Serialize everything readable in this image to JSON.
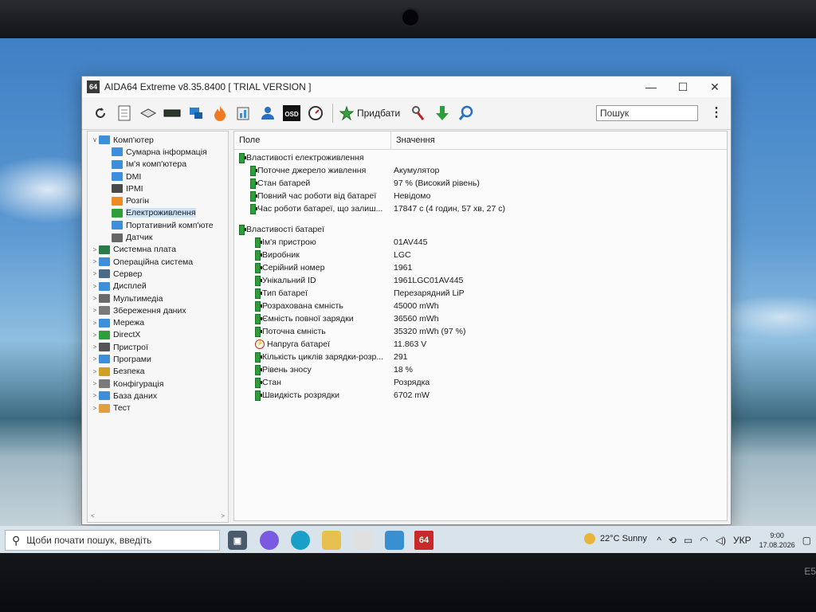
{
  "window": {
    "app_icon_text": "64",
    "title": "AIDA64 Extreme v8.35.8400  [ TRIAL VERSION ]",
    "minimize": "—",
    "maximize": "☐",
    "close": "✕"
  },
  "toolbar": {
    "add_label": "Придбати",
    "search_placeholder": "Пошук",
    "icons": [
      "refresh-icon",
      "report-icon",
      "motherboard-icon",
      "memory-icon",
      "network-icon",
      "flame-icon",
      "benchmark-icon",
      "user-icon",
      "osd-icon",
      "gauge-icon"
    ]
  },
  "tree": {
    "items": [
      {
        "label": "Комп'ютер",
        "level": 0,
        "expand": "∨",
        "color": "#3c8fd8"
      },
      {
        "label": "Сумарна інформація",
        "level": 1,
        "expand": "",
        "color": "#3c8fd8"
      },
      {
        "label": "Ім'я комп'ютера",
        "level": 1,
        "expand": "",
        "color": "#3c8fd8"
      },
      {
        "label": "DMI",
        "level": 1,
        "expand": "",
        "color": "#3c8fd8"
      },
      {
        "label": "IPMI",
        "level": 1,
        "expand": "",
        "color": "#4a4a4a"
      },
      {
        "label": "Розгін",
        "level": 1,
        "expand": "",
        "color": "#f08a24"
      },
      {
        "label": "Електроживлення",
        "level": 1,
        "expand": "",
        "color": "#2e9e3a",
        "selected": true
      },
      {
        "label": "Портативний комп'юте",
        "level": 1,
        "expand": "",
        "color": "#3c8fd8"
      },
      {
        "label": "Датчик",
        "level": 1,
        "expand": "",
        "color": "#666666"
      },
      {
        "label": "Системна плата",
        "level": 0,
        "expand": ">",
        "color": "#2a7a4a"
      },
      {
        "label": "Операційна система",
        "level": 0,
        "expand": ">",
        "color": "#3c8fd8"
      },
      {
        "label": "Сервер",
        "level": 0,
        "expand": ">",
        "color": "#4a6a8a"
      },
      {
        "label": "Дисплей",
        "level": 0,
        "expand": ">",
        "color": "#3c8fd8"
      },
      {
        "label": "Мультимедіа",
        "level": 0,
        "expand": ">",
        "color": "#6a6a6a"
      },
      {
        "label": "Збереження даних",
        "level": 0,
        "expand": ">",
        "color": "#7a7a7a"
      },
      {
        "label": "Мережа",
        "level": 0,
        "expand": ">",
        "color": "#3c8fd8"
      },
      {
        "label": "DirectX",
        "level": 0,
        "expand": ">",
        "color": "#2e9e3a"
      },
      {
        "label": "Пристрої",
        "level": 0,
        "expand": ">",
        "color": "#555555"
      },
      {
        "label": "Програми",
        "level": 0,
        "expand": ">",
        "color": "#3c8fd8"
      },
      {
        "label": "Безпека",
        "level": 0,
        "expand": ">",
        "color": "#d0a020"
      },
      {
        "label": "Конфігурація",
        "level": 0,
        "expand": ">",
        "color": "#7a7a7a"
      },
      {
        "label": "База даних",
        "level": 0,
        "expand": ">",
        "color": "#3c8fd8"
      },
      {
        "label": "Тест",
        "level": 0,
        "expand": ">",
        "color": "#e0a040"
      }
    ]
  },
  "panel": {
    "col_field": "Поле",
    "col_value": "Значення",
    "groups": [
      {
        "title": "Властивості електроживлення",
        "rows": [
          {
            "field": "Поточне джерело живлення",
            "value": "Акумулятор"
          },
          {
            "field": "Стан батарей",
            "value": "97 % (Високий рівень)"
          },
          {
            "field": "Повний час роботи від батареї",
            "value": "Невідомо"
          },
          {
            "field": "Час роботи батареї, що залиш...",
            "value": "17847 с (4 годин, 57 хв, 27 с)"
          }
        ]
      },
      {
        "title": "Властивості батареї",
        "rows": [
          {
            "field": "Ім'я пристрою",
            "value": "01AV445"
          },
          {
            "field": "Виробник",
            "value": "LGC"
          },
          {
            "field": "Серійний номер",
            "value": "1961"
          },
          {
            "field": "Унікальний ID",
            "value": "1961LGC01AV445"
          },
          {
            "field": "Тип батареї",
            "value": "Перезарядний LiP"
          },
          {
            "field": "Розрахована ємність",
            "value": "45000 mWh"
          },
          {
            "field": "Ємність повної зарядки",
            "value": "36560 mWh"
          },
          {
            "field": "Поточна ємність",
            "value": "35320 mWh  (97 %)"
          },
          {
            "field": "Напруга батареї",
            "value": "11.863 V",
            "icon": "voltage"
          },
          {
            "field": "Кількість циклів зарядки-розр...",
            "value": "291"
          },
          {
            "field": "Рівень зносу",
            "value": "18 %"
          },
          {
            "field": "Стан",
            "value": "Розрядка"
          },
          {
            "field": "Швидкість розрядки",
            "value": "6702 mW"
          }
        ]
      }
    ]
  },
  "taskbar": {
    "search_text": "Щоби почати пошук, введіть",
    "aida_icon_text": "64",
    "weather": "22°C  Sunny",
    "lang": "УКР",
    "time": "9:00",
    "date": "17.08.2026"
  },
  "bezel": {
    "left_label": "",
    "right_label": "E5"
  }
}
